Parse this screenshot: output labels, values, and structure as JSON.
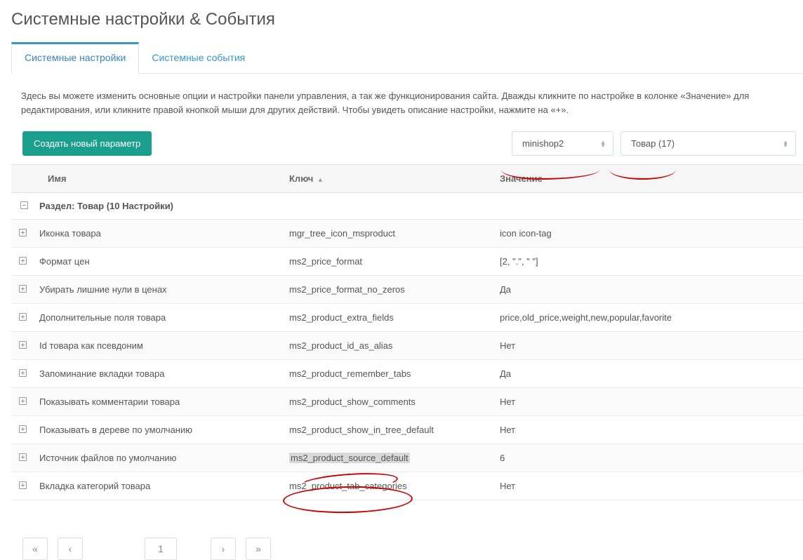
{
  "title": "Системные настройки & События",
  "tabs": {
    "settings": "Системные настройки",
    "events": "Системные события"
  },
  "description": "Здесь вы можете изменить основные опции и настройки панели управления, а так же функционирования сайта. Дважды кликните по настройке в колонке «Значение» для редактирования, или кликните правой кнопкой мыши для других действий. Чтобы увидеть описание настройки, нажмите на «+».",
  "buttons": {
    "create": "Создать новый параметр"
  },
  "filters": {
    "namespace": "minishop2",
    "area": "Товар (17)"
  },
  "columns": {
    "name": "Имя",
    "key": "Ключ",
    "value": "Значение"
  },
  "group": "Раздел: Товар (10 Настройки)",
  "rows": [
    {
      "name": "Иконка товара",
      "key": "mgr_tree_icon_msproduct",
      "value": "icon icon-tag",
      "vtype": "txt"
    },
    {
      "name": "Формат цен",
      "key": "ms2_price_format",
      "value": "[2, \".\", \" \"]",
      "vtype": "txt"
    },
    {
      "name": "Убирать лишние нули в ценах",
      "key": "ms2_price_format_no_zeros",
      "value": "Да",
      "vtype": "yes"
    },
    {
      "name": "Дополнительные поля товара",
      "key": "ms2_product_extra_fields",
      "value": "price,old_price,weight,new,popular,favorite",
      "vtype": "txt"
    },
    {
      "name": "Id товара как псевдоним",
      "key": "ms2_product_id_as_alias",
      "value": "Нет",
      "vtype": "no"
    },
    {
      "name": "Запоминание вкладки товара",
      "key": "ms2_product_remember_tabs",
      "value": "Да",
      "vtype": "yes"
    },
    {
      "name": "Показывать комментарии товара",
      "key": "ms2_product_show_comments",
      "value": "Нет",
      "vtype": "no"
    },
    {
      "name": "Показывать в дереве по умолчанию",
      "key": "ms2_product_show_in_tree_default",
      "value": "Нет",
      "vtype": "no"
    },
    {
      "name": "Источник файлов по умолчанию",
      "key": "ms2_product_source_default",
      "value": "6",
      "vtype": "txt",
      "highlight": true
    },
    {
      "name": "Вкладка категорий товара",
      "key": "ms2_product_tab_categories",
      "value": "Нет",
      "vtype": "no"
    }
  ],
  "pager": {
    "first": "«",
    "prev": "‹",
    "page": "1",
    "next": "›",
    "last": "»"
  }
}
